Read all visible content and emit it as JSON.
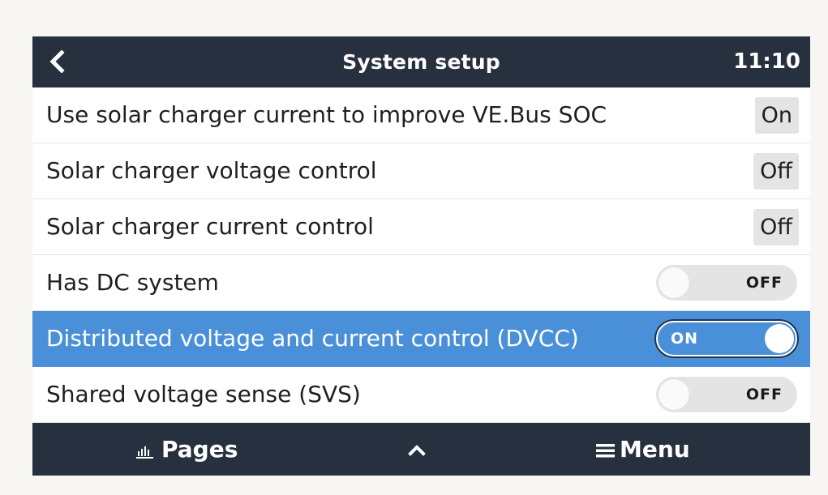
{
  "header": {
    "back_icon": "chevron-left-icon",
    "title": "System setup",
    "time": "11:10"
  },
  "settings": [
    {
      "label": "Use solar charger current to improve VE.Bus SOC",
      "type": "value",
      "value": "On"
    },
    {
      "label": "Solar charger voltage control",
      "type": "value",
      "value": "Off"
    },
    {
      "label": "Solar charger current control",
      "type": "value",
      "value": "Off"
    },
    {
      "label": "Has DC system",
      "type": "switch",
      "state": "OFF"
    },
    {
      "label": "Distributed voltage and current control (DVCC)",
      "type": "switch",
      "state": "ON",
      "selected": true
    },
    {
      "label": "Shared voltage sense (SVS)",
      "type": "switch",
      "state": "OFF"
    }
  ],
  "footer": {
    "pages_label": "Pages",
    "pages_icon": "bar-chart-icon",
    "up_icon": "chevron-up-icon",
    "menu_label": "Menu",
    "menu_icon": "hamburger-menu-icon"
  },
  "colors": {
    "header_bg": "#26303e",
    "selected_bg": "#4a90d9",
    "value_bg": "#e4e4e4"
  }
}
